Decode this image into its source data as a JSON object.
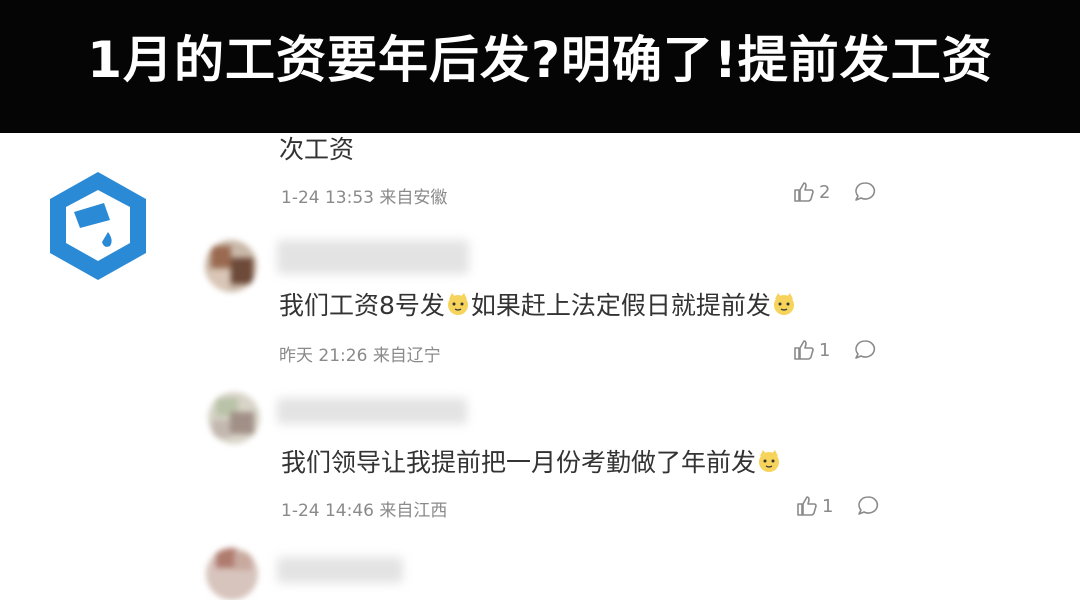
{
  "banner": {
    "title": "1月的工资要年后发?明确了!提前发工资"
  },
  "colors": {
    "banner_bg": "#050505",
    "logo_blue": "#2a8ad6",
    "text": "#333333",
    "meta": "#8a8a8a"
  },
  "comments": [
    {
      "text": "次工资",
      "time": "1-24 13:53",
      "location": "来自安徽",
      "likes": "2"
    },
    {
      "text_parts": [
        "我们工资8号发",
        "如果赶上法定假日就提前发"
      ],
      "time": "昨天 21:26",
      "location": "来自辽宁",
      "likes": "1"
    },
    {
      "text": "我们领导让我提前把一月份考勤做了年前发",
      "time": "1-24 14:46",
      "location": "来自江西",
      "likes": "1"
    }
  ],
  "icons": [
    "logo-icon",
    "thumbs-up-icon",
    "comment-icon",
    "cat-emoji-icon"
  ]
}
